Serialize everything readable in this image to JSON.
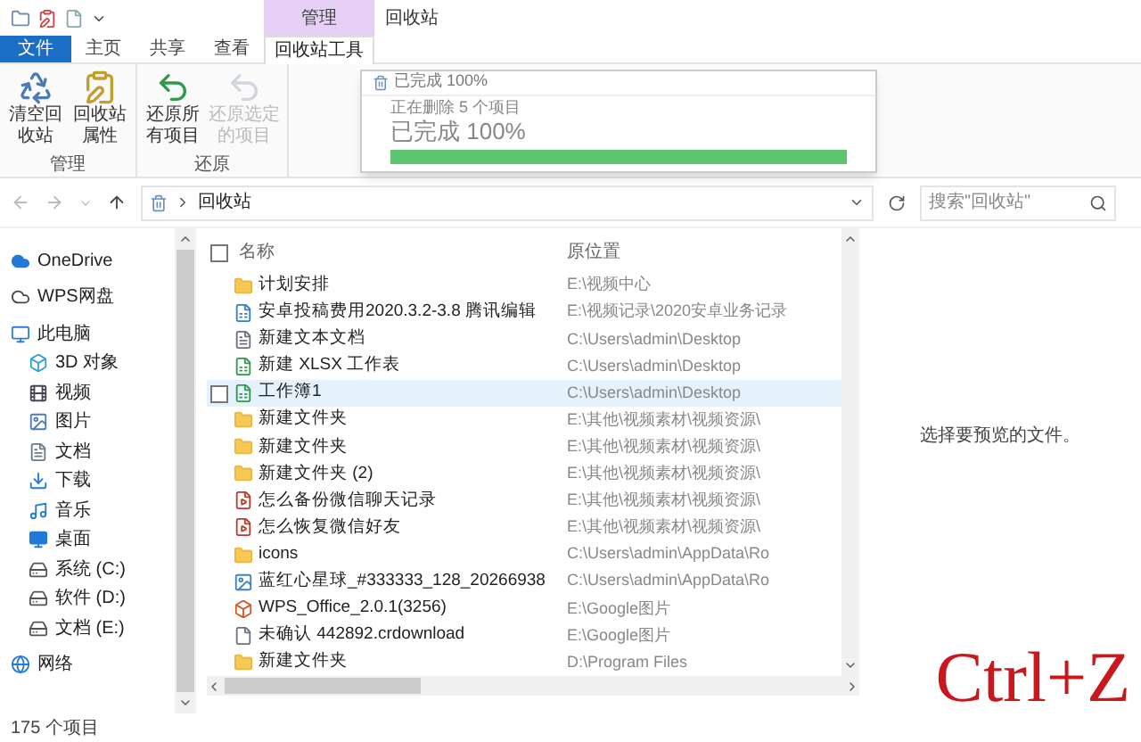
{
  "window": {
    "title": "回收站",
    "context_tab": "管理"
  },
  "tabs": [
    {
      "label": "文件",
      "kind": "file",
      "selected": false
    },
    {
      "label": "主页",
      "kind": "tab",
      "selected": false
    },
    {
      "label": "共享",
      "kind": "tab",
      "selected": false
    },
    {
      "label": "查看",
      "kind": "tab",
      "selected": false
    },
    {
      "label": "回收站工具",
      "kind": "tab",
      "selected": true
    }
  ],
  "ribbon": {
    "groups": [
      {
        "label": "管理",
        "buttons": [
          {
            "label": "清空回收站",
            "kind": "bin",
            "disabled": false
          },
          {
            "label": "回收站属性",
            "kind": "props",
            "disabled": false
          }
        ]
      },
      {
        "label": "还原",
        "buttons": [
          {
            "label": "还原所有项目",
            "kind": "restore",
            "disabled": false
          },
          {
            "label": "还原选定的项目",
            "kind": "restore",
            "disabled": true
          }
        ]
      }
    ]
  },
  "address": {
    "path": "回收站",
    "search_placeholder": "搜索\"回收站\""
  },
  "sidebar": {
    "items": [
      {
        "label": "OneDrive",
        "kind": "cloud"
      },
      {
        "label": "WPS网盘",
        "kind": "cloud-outline"
      },
      {
        "label": "此电脑",
        "kind": "pc",
        "children": [
          {
            "label": "3D 对象",
            "kind": "cube"
          },
          {
            "label": "视频",
            "kind": "video"
          },
          {
            "label": "图片",
            "kind": "image"
          },
          {
            "label": "文档",
            "kind": "doc"
          },
          {
            "label": "下载",
            "kind": "download"
          },
          {
            "label": "音乐",
            "kind": "music"
          },
          {
            "label": "桌面",
            "kind": "desktop"
          },
          {
            "label": "系统 (C:)",
            "kind": "drive"
          },
          {
            "label": "软件 (D:)",
            "kind": "drive"
          },
          {
            "label": "文档 (E:)",
            "kind": "drive"
          }
        ]
      },
      {
        "label": "网络",
        "kind": "network"
      }
    ]
  },
  "table": {
    "columns": [
      "名称",
      "原位置"
    ],
    "select_all": {
      "checked": false
    },
    "rows": [
      {
        "name": "计划安排",
        "location": "E:\\视频中心",
        "kind": "folder",
        "selected": false
      },
      {
        "name": "安卓投稿费用2020.3.2-3.8  腾讯编辑",
        "location": "E:\\视频记录\\2020安卓业务记录",
        "kind": "sheet",
        "selected": false
      },
      {
        "name": "新建文本文档",
        "location": "C:\\Users\\admin\\Desktop",
        "kind": "text",
        "selected": false
      },
      {
        "name": "新建 XLSX 工作表",
        "location": "C:\\Users\\admin\\Desktop",
        "kind": "xlsx",
        "selected": false
      },
      {
        "name": "工作簿1",
        "location": "C:\\Users\\admin\\Desktop",
        "kind": "xlsx",
        "selected": true
      },
      {
        "name": "新建文件夹",
        "location": "E:\\其他\\视频素材\\视频资源\\",
        "kind": "folder",
        "selected": false
      },
      {
        "name": "新建文件夹",
        "location": "E:\\其他\\视频素材\\视频资源\\",
        "kind": "folder",
        "selected": false
      },
      {
        "name": "新建文件夹 (2)",
        "location": "E:\\其他\\视频素材\\视频资源\\",
        "kind": "folder",
        "selected": false
      },
      {
        "name": "怎么备份微信聊天记录",
        "location": "E:\\其他\\视频素材\\视频资源\\",
        "kind": "video",
        "selected": false
      },
      {
        "name": "怎么恢复微信好友",
        "location": "E:\\其他\\视频素材\\视频资源\\",
        "kind": "video",
        "selected": false
      },
      {
        "name": "icons",
        "location": "C:\\Users\\admin\\AppData\\Ro",
        "kind": "folder",
        "selected": false
      },
      {
        "name": "蓝红心星球_#333333_128_20266938",
        "location": "C:\\Users\\admin\\AppData\\Ro",
        "kind": "image",
        "selected": false
      },
      {
        "name": "WPS_Office_2.0.1(3256)",
        "location": "E:\\Google图片",
        "kind": "app",
        "selected": false
      },
      {
        "name": "未确认 442892.crdownload",
        "location": "E:\\Google图片",
        "kind": "file",
        "selected": false
      },
      {
        "name": "新建文件夹",
        "location": "D:\\Program Files",
        "kind": "folder",
        "selected": false
      }
    ]
  },
  "preview": {
    "message": "选择要预览的文件。"
  },
  "progress_dialog": {
    "title": "已完成 100%",
    "task": "正在删除 5 个项目",
    "status": "已完成 100%",
    "level": 1
  },
  "caption": "Ctrl+Z",
  "status_bar": {
    "count": "175 个项目"
  }
}
